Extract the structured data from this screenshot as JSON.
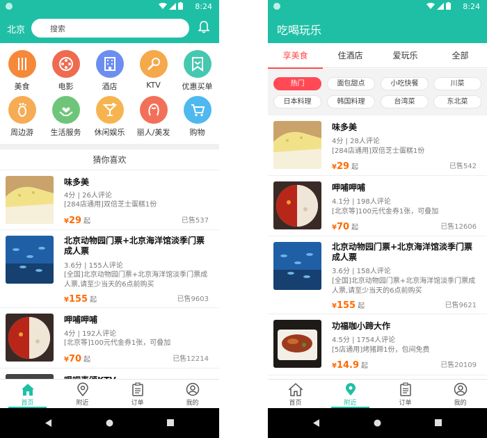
{
  "status": {
    "time": "8:24"
  },
  "left": {
    "city": "北京",
    "search_placeholder": "搜索",
    "categories": [
      {
        "label": "美食",
        "icon": "cutlery-icon",
        "color": "#f6883a"
      },
      {
        "label": "电影",
        "icon": "film-reel-icon",
        "color": "#ef6a4f"
      },
      {
        "label": "酒店",
        "icon": "building-icon",
        "color": "#6b8ef0"
      },
      {
        "label": "KTV",
        "icon": "microphone-icon",
        "color": "#f5a94b"
      },
      {
        "label": "优惠买单",
        "icon": "coupon-icon",
        "color": "#46c8b0"
      },
      {
        "label": "周边游",
        "icon": "footprint-icon",
        "color": "#f6ac54"
      },
      {
        "label": "生活服务",
        "icon": "hands-heart-icon",
        "color": "#6ec57a"
      },
      {
        "label": "休闲娱乐",
        "icon": "cocktail-icon",
        "color": "#f6b451"
      },
      {
        "label": "丽人/美发",
        "icon": "woman-head-icon",
        "color": "#f27059"
      },
      {
        "label": "购物",
        "icon": "cart-icon",
        "color": "#4fb8ef"
      }
    ],
    "section_title": "猜你喜欢",
    "items": [
      {
        "title": "味多美",
        "meta": "4分 | 26人评论",
        "desc": "[284店通用]双倍芝士蛋糕1份",
        "price": "29",
        "sold": "已售537",
        "img": "cake"
      },
      {
        "title": "北京动物园门票+北京海洋馆淡季门票成人票",
        "meta": "3.6分 | 155人评论",
        "desc": "[全国]北京动物园门票+北京海洋馆淡季门票成人票,请至少当天的6点前购买",
        "price": "155",
        "sold": "已售9603",
        "img": "fish"
      },
      {
        "title": "呷哺呷哺",
        "meta": "4分 | 192人评论",
        "desc": "[北京等]100元代金券1张，可叠加",
        "price": "70",
        "sold": "已售12214",
        "img": "hotpot"
      },
      {
        "title": "唱吧麦颂KTV",
        "img": "ktv"
      }
    ],
    "nav": [
      {
        "label": "首页",
        "icon": "home-icon",
        "active": true
      },
      {
        "label": "附近",
        "icon": "location-pin-icon",
        "active": false
      },
      {
        "label": "订单",
        "icon": "order-list-icon",
        "active": false
      },
      {
        "label": "我的",
        "icon": "user-icon",
        "active": false
      }
    ]
  },
  "right": {
    "title": "吃喝玩乐",
    "tabs": [
      "享美食",
      "住酒店",
      "爱玩乐",
      "全部"
    ],
    "chips": [
      "热门",
      "面包甜点",
      "小吃快餐",
      "川菜",
      "日本料理",
      "韩国料理",
      "台湾菜",
      "东北菜"
    ],
    "items": [
      {
        "title": "味多美",
        "meta": "4分 | 28人评论",
        "desc": "[284店通用]双倍芝士蛋糕1份",
        "price": "29",
        "sold": "已售542",
        "img": "cake"
      },
      {
        "title": "呷哺呷哺",
        "meta": "4.1分 | 198人评论",
        "desc": "[北京等]100元代金券1张，可叠加",
        "price": "70",
        "sold": "已售12606",
        "img": "hotpot"
      },
      {
        "title": "北京动物园门票+北京海洋馆淡季门票成人票",
        "meta": "3.6分 | 158人评论",
        "desc": "[全国]北京动物园门票+北京海洋馆淡季门票成人票,请至少当天的6点前购买",
        "price": "155",
        "sold": "已售9621",
        "img": "fish"
      },
      {
        "title": "功福咖小蹄大作",
        "meta": "4.5分 | 1754人评论",
        "desc": "[5店通用]烤猪蹄1份，包间免费",
        "price": "14.9",
        "sold": "已售20109",
        "img": "pork"
      }
    ],
    "nav": [
      {
        "label": "首页",
        "icon": "home-icon",
        "active": false
      },
      {
        "label": "附近",
        "icon": "location-pin-icon",
        "active": true
      },
      {
        "label": "订单",
        "icon": "order-list-icon",
        "active": false
      },
      {
        "label": "我的",
        "icon": "user-icon",
        "active": false
      }
    ]
  },
  "price_prefix": "¥",
  "price_suffix": "起"
}
